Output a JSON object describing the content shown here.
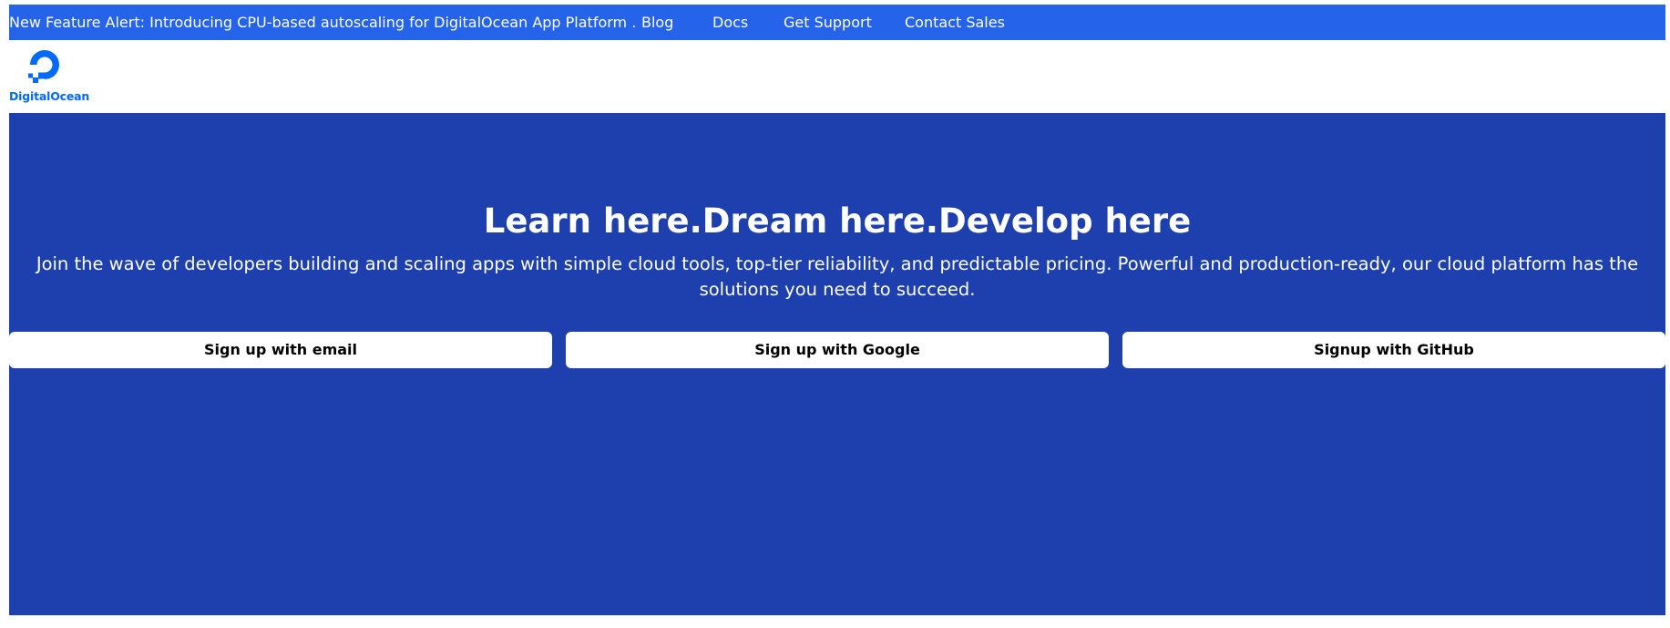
{
  "topbar": {
    "alert": "New Feature Alert: Introducing CPU-based autoscaling for DigitalOcean App Platform .",
    "nav": [
      "Blog",
      "Docs",
      "Get Support",
      "Contact Sales"
    ]
  },
  "logo": {
    "text": "DigitalOcean",
    "icon": "digitalocean-logo-icon"
  },
  "hero": {
    "title": "Learn here.Dream here.Develop here",
    "description": "Join the wave of developers building and scaling apps with simple cloud tools, top-tier reliability, and predictable pricing. Powerful and production-ready, our cloud platform has the solutions you need to succeed.",
    "buttons": [
      "Sign up with email",
      "Sign up with Google",
      "Signup with GitHub"
    ]
  },
  "colors": {
    "topbar": "#2563eb",
    "hero": "#1e40af",
    "brand": "#0069ff"
  }
}
